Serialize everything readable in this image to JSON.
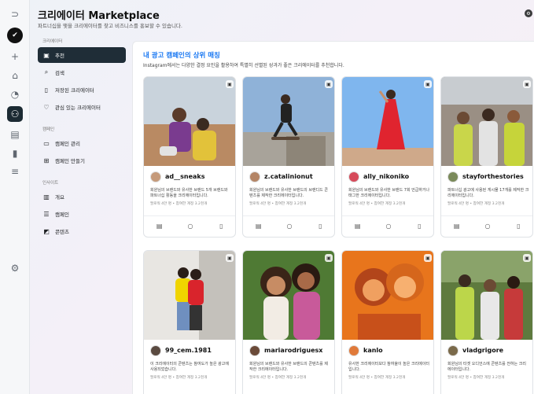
{
  "header": {
    "title": "크리에이터 Marketplace",
    "subtitle": "파트너십을 맺을 크리에이터를 찾고 비즈니스를 홍보할 수 있습니다."
  },
  "rail": {
    "icons": [
      "circle-arrow-icon",
      "brand-logo",
      "plus-icon",
      "home-icon",
      "notification-icon",
      "creators-icon",
      "messages-icon",
      "insights-icon",
      "menu-icon",
      "settings-icon"
    ]
  },
  "nav": {
    "section_creators": "크리에이터",
    "recommended": "추천",
    "search": "검색",
    "saved": "저장된 크리에이터",
    "interested": "관심 있는 크리에이터",
    "section_campaigns": "캠페인",
    "manage_campaigns": "캠페인 관리",
    "create_campaign": "캠페인 만들기",
    "section_insights": "인사이트",
    "overview": "개요",
    "campaigns": "캠페인",
    "content": "콘텐츠"
  },
  "main": {
    "section_title": "내 광고 캠페인의 상위 매칭",
    "section_desc": "Instagram에서는 다양한 결정 요인을 활용하여 특별히 선별된 성과가 좋은 크리에이터를 추천합니다."
  },
  "cards": [
    {
      "handle": "ad__sneaks",
      "bio": "회원님의 브랜드와 유사한 브랜드 5개 브랜드와 파트너십 활동을 크리에이터입니다.",
      "stats": "팔로워 4만 명 • 참여한 계정 3.2천개"
    },
    {
      "handle": "z.catalinionut",
      "bio": "회원님의 브랜드와 유사한 브랜드의 브랜디드 콘텐츠를 제작한 크리에이터입니다.",
      "stats": "팔로워 4만 명 • 참여한 계정 3.2천개"
    },
    {
      "handle": "ally_nikoniko",
      "bio": "회원님의 브랜드와 유사한 브랜드 7회 언급하거나 태그한 크리에이터입니다.",
      "stats": "팔로워 4만 명 • 참여한 계정 3.2천개"
    },
    {
      "handle": "stayforthestories",
      "bio": "파트너십 광고에 사용된 게시물 17개를 제작한 크리에이터입니다.",
      "stats": "팔로워 4만 명 • 참여한 계정 3.2천개"
    },
    {
      "handle": "99_cem.1981",
      "bio": "이 크리에이터의 콘텐츠는 참여도가 높은 광고에 사용되었습니다.",
      "stats": "팔로워 4만 명 • 참여한 계정 3.2천개"
    },
    {
      "handle": "mariarodriguesx",
      "bio": "회원님의 브랜드와 유사한 브랜드의 콘텐츠를 제작한 크리에이터입니다.",
      "stats": "팔로워 4만 명 • 참여한 계정 3.2천개"
    },
    {
      "handle": "kanlo",
      "bio": "유사한 크리에이터보다 참여율이 높은 크리에이터입니다.",
      "stats": "팔로워 4만 명 • 참여한 계정 3.2천개"
    },
    {
      "handle": "vladgrigore",
      "bio": "회원님의 타겟 오디언스에 콘텐츠를 전하는 크리에이터입니다.",
      "stats": "팔로워 4만 명 • 참여한 계정 3.2천개"
    }
  ],
  "card_actions": [
    "media-kit-icon",
    "message-icon",
    "save-icon"
  ],
  "colors": {
    "accent": "#1877f2",
    "nav_active": "#1f2d37"
  }
}
